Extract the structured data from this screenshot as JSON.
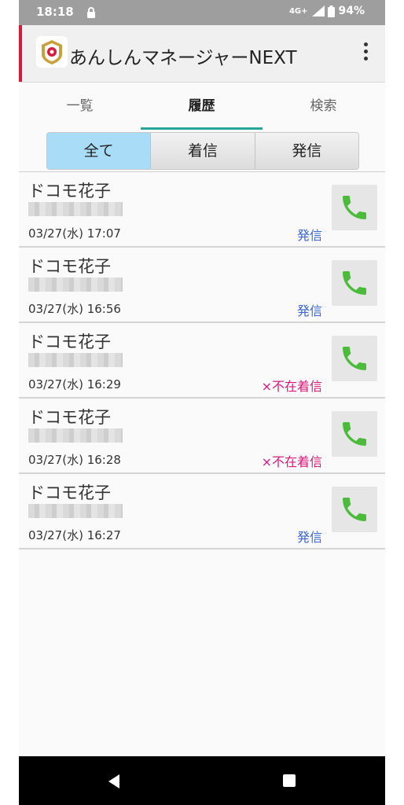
{
  "status_bar": {
    "time": "18:18",
    "network": "4G+",
    "battery": "94%"
  },
  "app": {
    "title": "あんしんマネージャーNEXT",
    "accent_color": "#d81b3c"
  },
  "tabs": [
    {
      "label": "一覧",
      "active": false
    },
    {
      "label": "履歴",
      "active": true
    },
    {
      "label": "検索",
      "active": false
    }
  ],
  "filters": [
    {
      "label": "全て",
      "active": true
    },
    {
      "label": "着信",
      "active": false
    },
    {
      "label": "発信",
      "active": false
    }
  ],
  "history": [
    {
      "name": "ドコモ花子",
      "datetime": "03/27(水) 17:07",
      "type": "発信"
    },
    {
      "name": "ドコモ花子",
      "datetime": "03/27(水) 16:56",
      "type": "発信"
    },
    {
      "name": "ドコモ花子",
      "datetime": "03/27(水) 16:29",
      "type": "×不在着信"
    },
    {
      "name": "ドコモ花子",
      "datetime": "03/27(水) 16:28",
      "type": "×不在着信"
    },
    {
      "name": "ドコモ花子",
      "datetime": "03/27(水) 16:27",
      "type": "発信"
    }
  ],
  "icons": {
    "call": "phone-icon",
    "menu": "more-vert-icon",
    "lock": "lock-icon"
  },
  "colors": {
    "outgoing": "#3b67d8",
    "missed": "#d81b7a",
    "call_icon": "#4cbb3c",
    "tab_indicator": "#26a69a",
    "active_filter": "#a8dcf7"
  }
}
